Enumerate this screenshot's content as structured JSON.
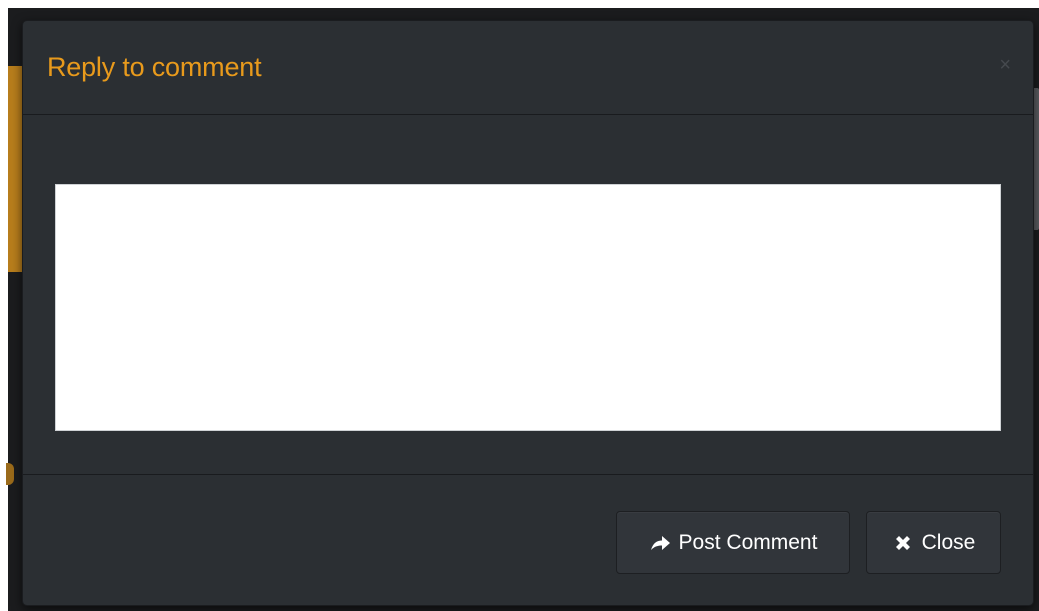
{
  "modal": {
    "title": "Reply to comment",
    "close_symbol": "×",
    "textarea": {
      "value": "",
      "placeholder": ""
    },
    "buttons": {
      "post_label": "Post Comment",
      "post_icon": "share-arrow-icon",
      "close_label": "Close",
      "close_icon": "x-icon"
    }
  },
  "colors": {
    "modal_bg": "#2b2f33",
    "title": "#e89a1c",
    "button_bg": "#31353a",
    "textarea_bg": "#ffffff"
  }
}
